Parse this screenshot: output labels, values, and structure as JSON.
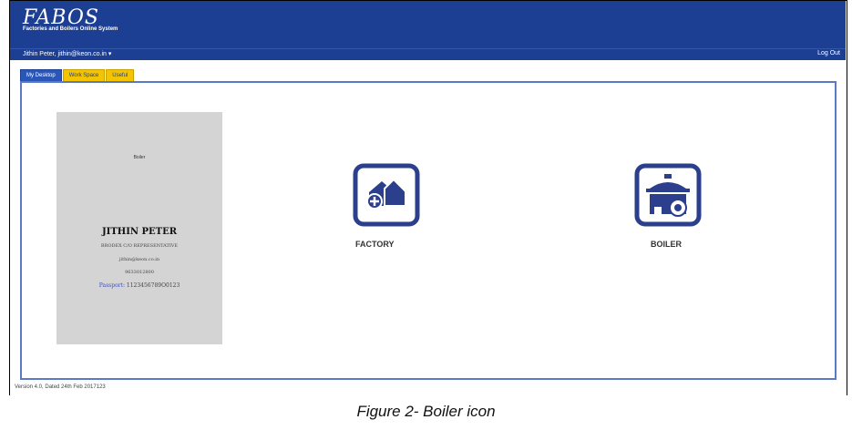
{
  "header": {
    "logo": "FABOS",
    "tagline": "Factories and Boilers Online System",
    "user": "Jithin Peter, jithin@keon.co.in",
    "logout_label": "Log Out"
  },
  "tabs": [
    {
      "label": "My Desktop",
      "active": true
    },
    {
      "label": "Work Space",
      "active": false
    },
    {
      "label": "Useful",
      "active": false
    }
  ],
  "profile": {
    "subtitle": "Boiler",
    "name": "JITHIN PETER",
    "designation": "BRODEX C/O REPRESENTATIVE",
    "email": "jithin@keon.co.in",
    "phone": "9633012800",
    "passport_label": "Passport:",
    "passport_value": "1123456789O0123"
  },
  "modules": [
    {
      "label": "FACTORY",
      "icon": "factory-icon"
    },
    {
      "label": "BOILER",
      "icon": "boiler-icon"
    }
  ],
  "footer": {
    "version": "Version 4.0, Dated 24th Feb 2017123"
  },
  "caption": "Figure 2- Boiler icon",
  "colors": {
    "header_bg": "#1c3f94",
    "tab_inactive": "#f5c400",
    "tab_active": "#2a56b8",
    "icon_border": "#2b3f8c"
  }
}
